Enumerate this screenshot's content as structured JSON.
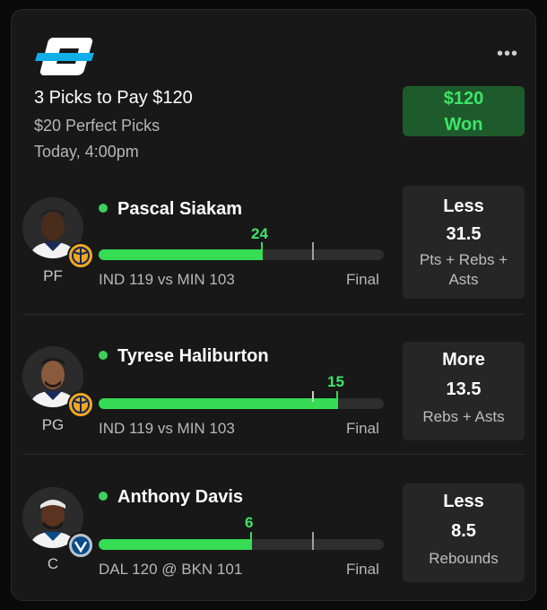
{
  "header": {
    "title": "3 Picks to Pay $120",
    "subtitle": "$20 Perfect Picks",
    "time": "Today, 4:00pm",
    "result_amount": "$120",
    "result_label": "Won",
    "more_label": "•••"
  },
  "picks": [
    {
      "name": "Pascal Siakam",
      "position": "PF",
      "game": "IND 119 vs MIN 103",
      "status": "Final",
      "actual": "24",
      "line": 31.5,
      "progress": 0.763,
      "direction": "Less",
      "line_label": "31.5",
      "stat": "Pts + Rebs + Asts",
      "team_icon": "pacers-logo-icon",
      "team_color": "#f2a81d"
    },
    {
      "name": "Tyrese Haliburton",
      "position": "PG",
      "game": "IND 119 vs MIN 103",
      "status": "Final",
      "actual": "15",
      "line": 13.5,
      "progress": 1.111,
      "direction": "More",
      "line_label": "13.5",
      "stat": "Rebs + Asts",
      "team_icon": "pacers-logo-icon",
      "team_color": "#f2a81d"
    },
    {
      "name": "Anthony Davis",
      "position": "C",
      "game": "DAL 120 @ BKN 101",
      "status": "Final",
      "actual": "6",
      "line": 8.5,
      "progress": 0.706,
      "direction": "Less",
      "line_label": "8.5",
      "stat": "Rebounds",
      "team_icon": "mavericks-logo-icon",
      "team_color": "#b8c4ca"
    }
  ],
  "colors": {
    "accent_green": "#35dc54",
    "won_bg": "#1e5b2c",
    "card_bg": "#181818"
  }
}
